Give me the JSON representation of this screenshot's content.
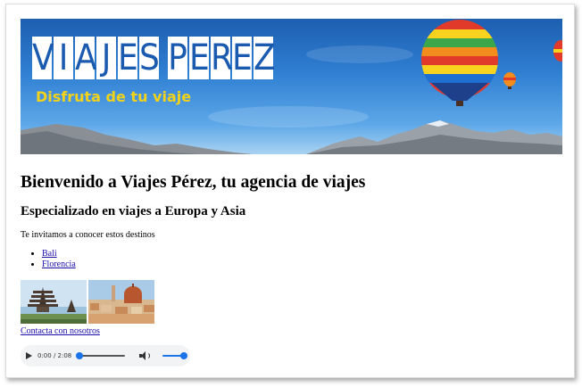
{
  "banner": {
    "logo_letters": [
      "V",
      "I",
      "A",
      "J",
      "E",
      "S",
      "",
      "P",
      "E",
      "R",
      "E",
      "Z"
    ],
    "tagline": "Disfruta de tu viaje",
    "colors": {
      "sky_top": "#1d5fb0",
      "logo_text": "#1a5bb0",
      "tagline": "#f2d21a"
    }
  },
  "heading": "Bienvenido a Viajes Pérez, tu agencia de viajes",
  "subheading": "Especializado en viajes a Europa y Asia",
  "intro": "Te invitamos a conocer estos destinos",
  "destinations": [
    {
      "label": "Bali"
    },
    {
      "label": "Florencia"
    }
  ],
  "thumbnails": [
    {
      "icon": "bali-temple-image"
    },
    {
      "icon": "florence-city-image"
    }
  ],
  "contact_link": "Contacta con nosotros",
  "audio": {
    "time": "0:00 / 2:08",
    "progress": 0,
    "volume": 1
  }
}
